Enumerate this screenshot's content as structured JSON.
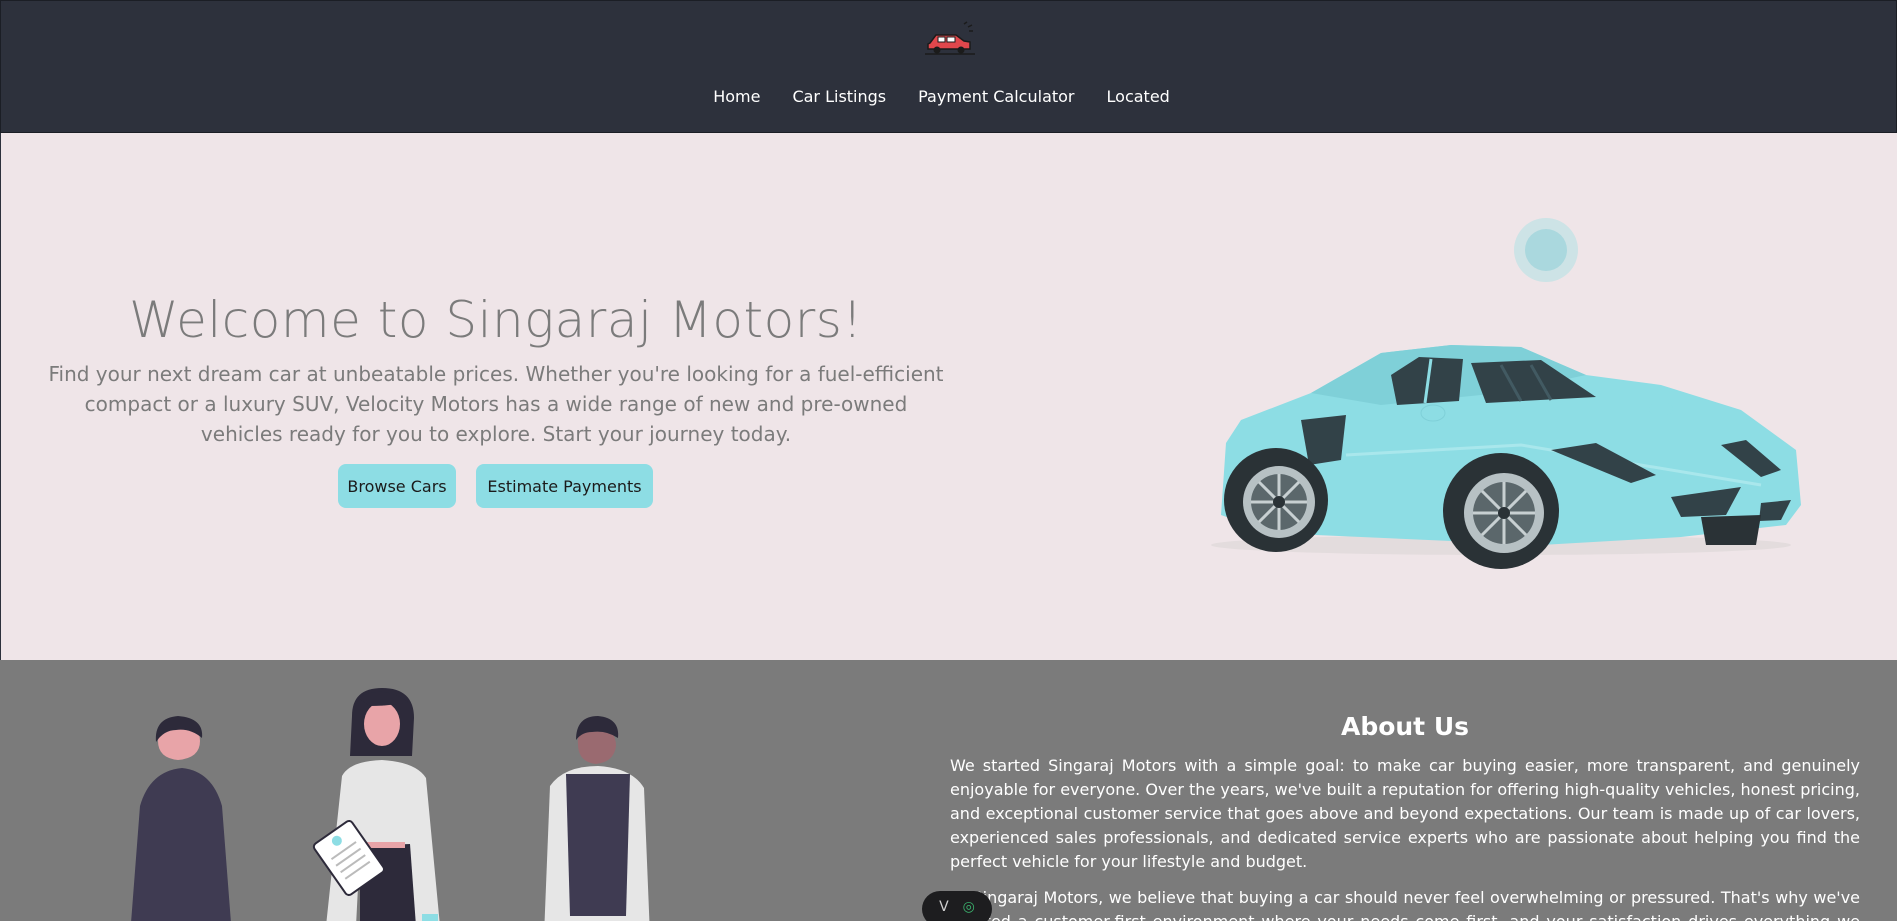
{
  "nav": {
    "items": [
      "Home",
      "Car Listings",
      "Payment Calculator",
      "Located"
    ]
  },
  "hero": {
    "title": "Welcome to Singaraj Motors!",
    "text": "Find your next dream car at unbeatable prices. Whether you're looking for a fuel-efficient compact or a luxury SUV, Velocity Motors has a wide range of new and pre-owned vehicles ready for you to explore. Start your journey today.",
    "browse_label": "Browse Cars",
    "estimate_label": "Estimate Payments"
  },
  "about": {
    "title": "About Us",
    "p1": "We started Singaraj Motors with a simple goal: to make car buying easier, more transparent, and genuinely enjoyable for everyone. Over the years, we've built a reputation for offering high-quality vehicles, honest pricing, and exceptional customer service that goes above and beyond expectations. Our team is made up of car lovers, experienced sales professionals, and dedicated service experts who are passionate about helping you find the perfect vehicle for your lifestyle and budget.",
    "p2": "At Singaraj Motors, we believe that buying a car should never feel overwhelming or pressured. That's why we've created a customer-first environment where your needs come first, and your satisfaction drives everything we do."
  },
  "colors": {
    "header_bg": "#2d313c",
    "hero_bg": "#efe5e8",
    "about_bg": "#7b7b7b",
    "accent": "#8ddde4",
    "logo_red": "#e0474c"
  },
  "icons": {
    "logo": "car-logo-icon",
    "dock_left": "chevron-v-icon",
    "dock_right": "target-icon"
  }
}
